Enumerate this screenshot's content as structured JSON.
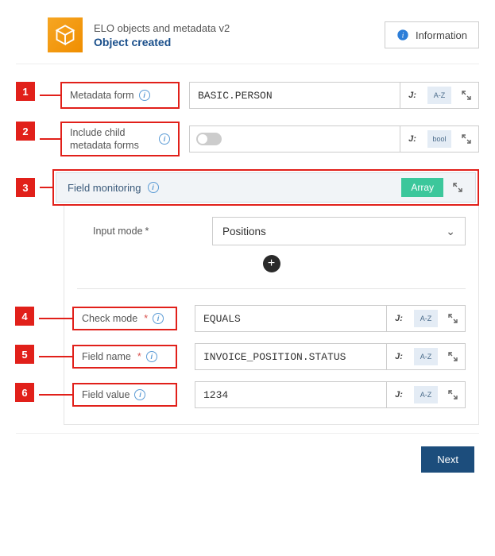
{
  "header": {
    "title_line1": "ELO objects and metadata  v2",
    "title_line2": "Object created",
    "info_button": "Information"
  },
  "callouts": [
    "1",
    "2",
    "3",
    "4",
    "5",
    "6"
  ],
  "fields": {
    "metadata_form": {
      "label": "Metadata form",
      "value": "BASIC.PERSON",
      "type_tag": "A-Z"
    },
    "include_child": {
      "label": "Include child metadata forms",
      "type_tag": "bool"
    },
    "field_monitoring": {
      "label": "Field monitoring",
      "badge": "Array"
    },
    "input_mode": {
      "label": "Input mode",
      "value": "Positions"
    },
    "check_mode": {
      "label": "Check mode",
      "value": "EQUALS",
      "type_tag": "A-Z"
    },
    "field_name": {
      "label": "Field name",
      "value": "INVOICE_POSITION.STATUS",
      "type_tag": "A-Z"
    },
    "field_value": {
      "label": "Field value",
      "value": "1234",
      "type_tag": "A-Z"
    }
  },
  "footer": {
    "next": "Next"
  },
  "jlabel": "J:"
}
